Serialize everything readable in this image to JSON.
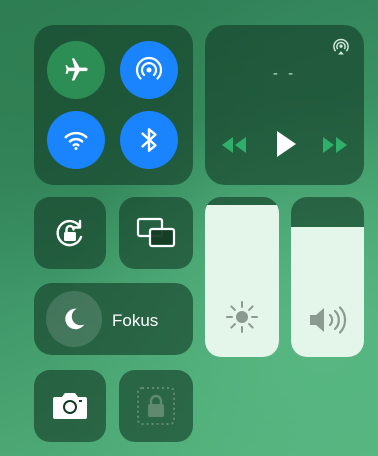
{
  "connectivity": {
    "airplane_icon": "airplane-icon",
    "airdrop_icon": "airdrop-icon",
    "wifi_icon": "wifi-icon",
    "bluetooth_icon": "bluetooth-icon",
    "colors": {
      "active_green": "#2c8d55",
      "active_blue": "#1a84ff"
    }
  },
  "media": {
    "track_title": "- -",
    "airplay_icon": "airplay-icon",
    "previous_icon": "rewind-icon",
    "play_icon": "play-icon",
    "next_icon": "fast-forward-icon"
  },
  "toggles": {
    "rotation_lock_icon": "rotation-lock-icon",
    "screen_mirroring_icon": "screen-mirroring-icon",
    "camera_icon": "camera-icon",
    "lock_icon": "lock-icon"
  },
  "focus": {
    "label": "Fokus",
    "icon": "moon-icon"
  },
  "sliders": {
    "brightness": {
      "icon": "sun-icon",
      "level_percent": 95
    },
    "volume": {
      "icon": "speaker-icon",
      "level_percent": 81
    }
  }
}
